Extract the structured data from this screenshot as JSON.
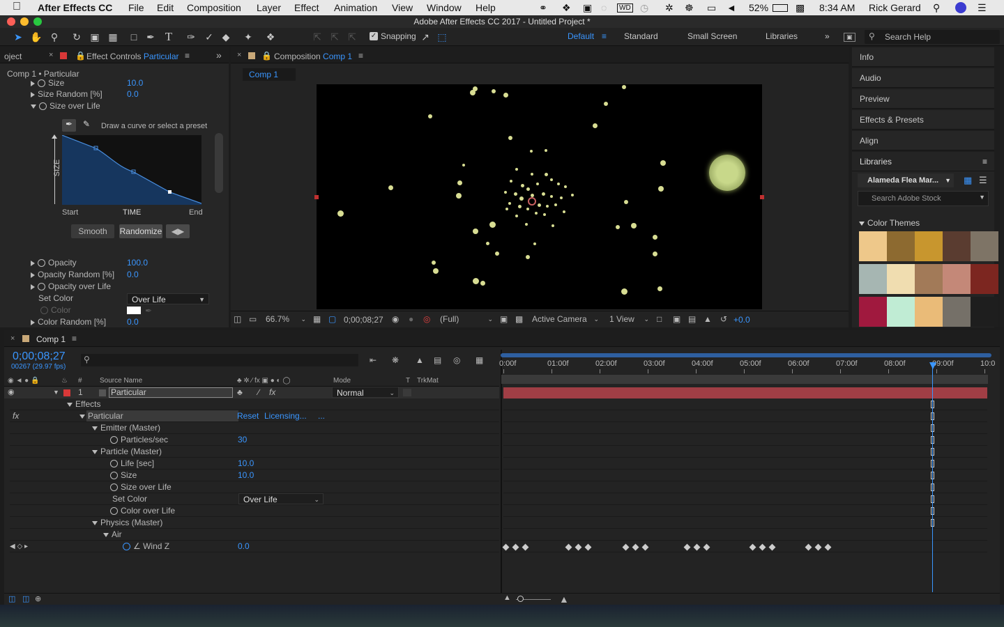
{
  "menubar": {
    "app_name": "After Effects CC",
    "items": [
      "File",
      "Edit",
      "Composition",
      "Layer",
      "Effect",
      "Animation",
      "View",
      "Window",
      "Help"
    ],
    "battery": "52%",
    "time": "8:34 AM",
    "user": "Rick Gerard"
  },
  "window": {
    "title": "Adobe After Effects CC 2017 - Untitled Project *"
  },
  "toolbar": {
    "snapping_label": "Snapping",
    "workspaces": [
      "Default",
      "Standard",
      "Small Screen",
      "Libraries"
    ],
    "active_workspace": "Default",
    "search_placeholder": "Search Help"
  },
  "effect_controls": {
    "project_tab": "oject",
    "tab_prefix": "Effect Controls",
    "tab_layer": "Particular",
    "breadcrumb": "Comp 1 • Particular",
    "rows": [
      {
        "label": "Size",
        "value": "10.0"
      },
      {
        "label": "Size Random [%]",
        "value": "0.0"
      },
      {
        "label": "Size over Life",
        "value": ""
      }
    ],
    "graph": {
      "hint": "Draw a curve or select a preset",
      "y_label": "SIZE",
      "x_start": "Start",
      "x_mid": "TIME",
      "x_end": "End",
      "smooth_label": "Smooth",
      "randomize_label": "Randomize"
    },
    "rows2": [
      {
        "label": "Opacity",
        "value": "100.0"
      },
      {
        "label": "Opacity Random [%]",
        "value": "0.0"
      },
      {
        "label": "Opacity over Life",
        "value": ""
      }
    ],
    "set_color_label": "Set Color",
    "set_color_value": "Over Life",
    "color_label": "Color",
    "color_random_label": "Color Random [%]",
    "color_random_value": "0.0"
  },
  "composition": {
    "tab_prefix": "Composition",
    "tab_name": "Comp 1",
    "sub_tab": "Comp 1",
    "zoom": "66.7%",
    "timecode": "0;00;08;27",
    "resolution": "(Full)",
    "camera": "Active Camera",
    "views": "1 View",
    "exposure": "+0.0"
  },
  "right_panels": {
    "items": [
      "Info",
      "Audio",
      "Preview",
      "Effects & Presets",
      "Align"
    ],
    "libraries_title": "Libraries",
    "library_name": "Alameda Flea Mar...",
    "stock_search_placeholder": "Search Adobe Stock",
    "color_themes_label": "Color Themes",
    "themes": [
      [
        "#eec88a",
        "#8d6a30",
        "#c8962e",
        "#5a3c30",
        "#7e7466"
      ],
      [
        "#a6b6b2",
        "#f0ddb0",
        "#a27a58",
        "#c48878",
        "#7c2620"
      ],
      [
        "#a0193e",
        "#c0ecd4",
        "#eabb78",
        "#757068",
        "#1e1e1e"
      ]
    ]
  },
  "timeline": {
    "tab": "Comp 1",
    "timecode": "0;00;08;27",
    "frame_info": "00267 (29.97 fps)",
    "ruler": [
      "0:00f",
      "01:00f",
      "02:00f",
      "03:00f",
      "04:00f",
      "05:00f",
      "06:00f",
      "07:00f",
      "08:00f",
      "09:00f",
      "10:0"
    ],
    "col_source_name": "Source Name",
    "col_mode": "Mode",
    "col_t": "T",
    "col_trkmat": "TrkMat",
    "layer": {
      "index": "1",
      "name": "Particular",
      "mode": "Normal"
    },
    "props": [
      {
        "label": "Effects",
        "value": ""
      },
      {
        "label": "Particular",
        "value": ""
      },
      {
        "label": "Emitter (Master)",
        "value": ""
      },
      {
        "label": "Particles/sec",
        "value": "30"
      },
      {
        "label": "Particle (Master)",
        "value": ""
      },
      {
        "label": "Life [sec]",
        "value": "10.0"
      },
      {
        "label": "Size",
        "value": "10.0"
      },
      {
        "label": "Size over Life",
        "value": ""
      },
      {
        "label": "Set Color",
        "value": "Over Life"
      },
      {
        "label": "Color over Life",
        "value": ""
      },
      {
        "label": "Physics (Master)",
        "value": ""
      },
      {
        "label": "Air",
        "value": ""
      },
      {
        "label": "Wind Z",
        "value": "0.0"
      }
    ],
    "reset_label": "Reset",
    "licensing_label": "Licensing...",
    "more_label": "..."
  }
}
